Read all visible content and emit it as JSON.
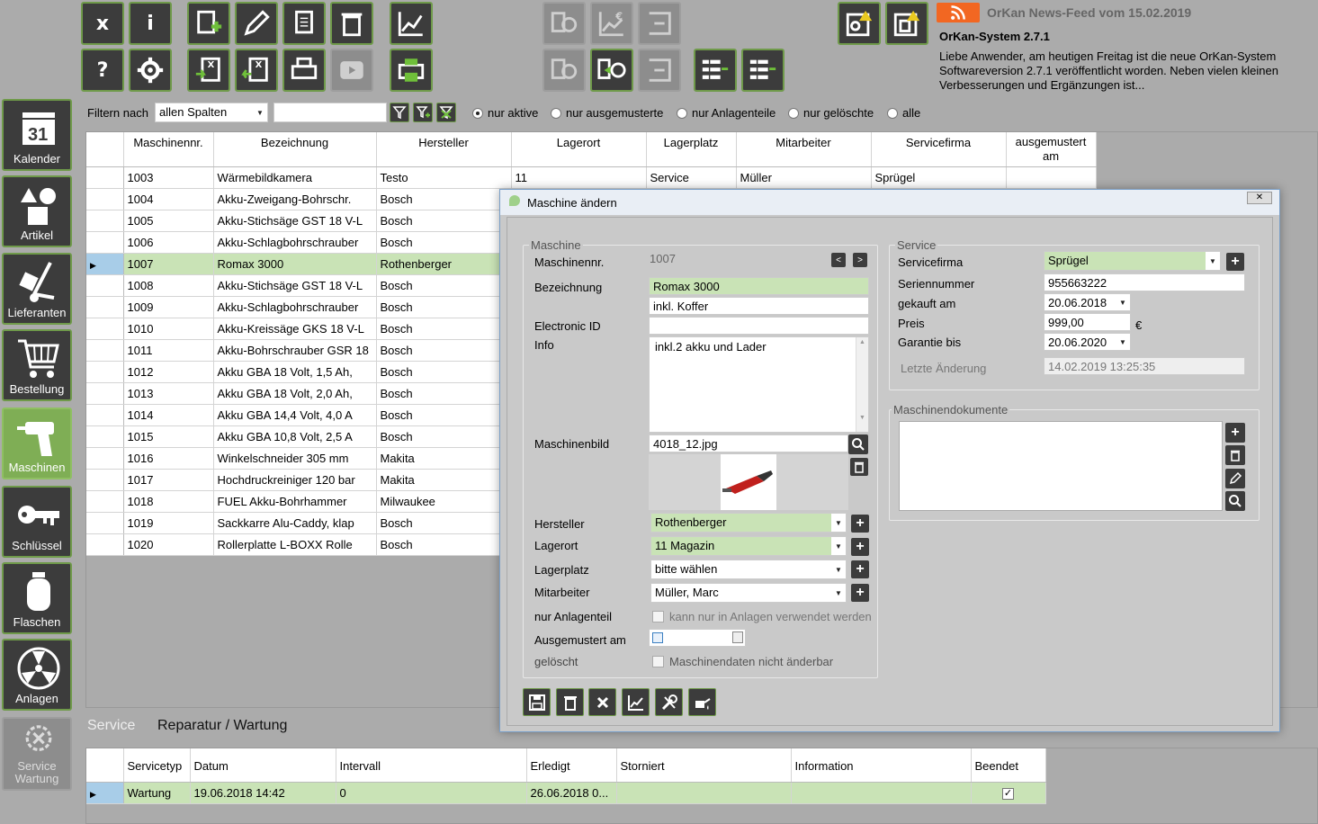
{
  "toolbar": {
    "close_label": "x",
    "info_label": "i",
    "help_label": "?"
  },
  "news": {
    "feed_title": "OrKan News-Feed vom 15.02.2019",
    "headline": "OrKan-System 2.7.1",
    "body": "Liebe Anwender, am heutigen Freitag ist die neue OrKan-System Softwareversion 2.7.1 veröffentlicht worden. Neben vielen kleinen Verbesserungen und Ergänzungen ist...",
    "icon": "rss-icon",
    "accent": "#f26722"
  },
  "sidebar": {
    "items": [
      {
        "label": "Kalender",
        "icon": "calendar-icon",
        "day": "31"
      },
      {
        "label": "Artikel",
        "icon": "shapes-icon"
      },
      {
        "label": "Lieferanten",
        "icon": "hand-truck-icon"
      },
      {
        "label": "Bestellung",
        "icon": "cart-icon"
      },
      {
        "label": "Maschinen",
        "icon": "drill-icon"
      },
      {
        "label": "Schlüssel",
        "icon": "key-icon"
      },
      {
        "label": "Flaschen",
        "icon": "bottle-icon"
      },
      {
        "label": "Anlagen",
        "icon": "fan-icon"
      },
      {
        "label": "Service\nWartung",
        "icon": "service-icon"
      }
    ]
  },
  "filter": {
    "label": "Filtern nach",
    "column_select": "allen Spalten",
    "search_value": "",
    "radios": [
      "nur aktive",
      "nur ausgemusterte",
      "nur Anlagenteile",
      "nur gelöschte",
      "alle"
    ],
    "selected_radio": "nur aktive"
  },
  "machine_table": {
    "columns": [
      "Maschinennr.",
      "Bezeichnung",
      "Hersteller",
      "Lagerort",
      "Lagerplatz",
      "Mitarbeiter",
      "Servicefirma",
      "ausgemustert am"
    ],
    "rows": [
      [
        "1003",
        "Wärmebildkamera",
        "Testo",
        "11",
        "Service",
        "Müller",
        "Sprügel",
        ""
      ],
      [
        "1004",
        "Akku-Zweigang-Bohrschr.",
        "Bosch",
        "",
        "",
        "",
        "",
        ""
      ],
      [
        "1005",
        "Akku-Stichsäge GST 18 V-L",
        "Bosch",
        "",
        "",
        "",
        "",
        ""
      ],
      [
        "1006",
        "Akku-Schlagbohrschrauber",
        "Bosch",
        "",
        "",
        "",
        "",
        ""
      ],
      [
        "1007",
        "Romax 3000",
        "Rothenberger",
        "",
        "",
        "",
        "",
        ""
      ],
      [
        "1008",
        "Akku-Stichsäge GST 18 V-L",
        "Bosch",
        "",
        "",
        "",
        "",
        ""
      ],
      [
        "1009",
        "Akku-Schlagbohrschrauber",
        "Bosch",
        "",
        "",
        "",
        "",
        ""
      ],
      [
        "1010",
        "Akku-Kreissäge GKS 18 V-L",
        "Bosch",
        "",
        "",
        "",
        "",
        ""
      ],
      [
        "1011",
        "Akku-Bohrschrauber GSR 18",
        "Bosch",
        "",
        "",
        "",
        "",
        ""
      ],
      [
        "1012",
        "Akku GBA 18 Volt, 1,5 Ah,",
        "Bosch",
        "",
        "",
        "",
        "",
        ""
      ],
      [
        "1013",
        "Akku GBA 18 Volt, 2,0 Ah,",
        "Bosch",
        "",
        "",
        "",
        "",
        ""
      ],
      [
        "1014",
        "Akku GBA 14,4 Volt, 4,0 A",
        "Bosch",
        "",
        "",
        "",
        "",
        ""
      ],
      [
        "1015",
        "Akku GBA 10,8 Volt, 2,5 A",
        "Bosch",
        "",
        "",
        "",
        "",
        ""
      ],
      [
        "1016",
        "Winkelschneider 305 mm",
        "Makita",
        "",
        "",
        "",
        "",
        ""
      ],
      [
        "1017",
        "Hochdruckreiniger 120 bar",
        "Makita",
        "",
        "",
        "",
        "",
        ""
      ],
      [
        "1018",
        "FUEL Akku-Bohrhammer",
        "Milwaukee",
        "",
        "",
        "",
        "",
        ""
      ],
      [
        "1019",
        "Sackkarre Alu-Caddy, klap",
        "Bosch",
        "",
        "",
        "",
        "",
        ""
      ],
      [
        "1020",
        "Rollerplatte L-BOXX Rolle",
        "Bosch",
        "",
        "",
        "",
        "",
        ""
      ]
    ],
    "selected_row": 4
  },
  "bottom_tabs": {
    "service": "Service",
    "repair": "Reparatur / Wartung"
  },
  "service_table": {
    "columns": [
      "Servicetyp",
      "Datum",
      "Intervall",
      "Erledigt",
      "Storniert",
      "Information",
      "Beendet"
    ],
    "rows": [
      [
        "Wartung",
        "19.06.2018 14:42",
        "0",
        "26.06.2018 0...",
        "",
        "",
        "checked"
      ]
    ]
  },
  "dialog": {
    "title": "Maschine ändern",
    "close": "✕",
    "machine_group": "Maschine",
    "labels": {
      "nr": "Maschinennr.",
      "bezeichnung": "Bezeichnung",
      "electronic_id": "Electronic ID",
      "info": "Info",
      "bild": "Maschinenbild",
      "hersteller": "Hersteller",
      "lagerort": "Lagerort",
      "lagerplatz": "Lagerplatz",
      "mitarbeiter": "Mitarbeiter",
      "anlagenteil": "nur Anlagenteil",
      "ausgemustert": "Ausgemustert am",
      "geloescht": "gelöscht"
    },
    "values": {
      "nr": "1007",
      "bezeichnung": "Romax 3000",
      "bezeichnung2": "inkl. Koffer",
      "electronic_id": "",
      "info": "inkl.2 akku und Lader",
      "bild": "4018_12.jpg",
      "hersteller": "Rothenberger",
      "lagerort": "11 Magazin",
      "lagerplatz": "bitte wählen",
      "mitarbeiter": "Müller, Marc",
      "anlagenteil_text": "kann nur in Anlagen verwendet werden",
      "geloescht_text": "Maschinendaten nicht änderbar",
      "ausgemustert": ""
    },
    "service_group": "Service",
    "service_labels": {
      "firma": "Servicefirma",
      "seriennummer": "Seriennummer",
      "gekauft": "gekauft am",
      "preis": "Preis",
      "garantie": "Garantie bis",
      "letzte": "Letzte Änderung"
    },
    "service_values": {
      "firma": "Sprügel",
      "seriennummer": "955663222",
      "gekauft": "20.06.2018",
      "preis": "999,00",
      "currency": "€",
      "garantie": "20.06.2020",
      "letzte": "14.02.2019 13:25:35"
    },
    "docs_group": "Maschinendokumente"
  }
}
